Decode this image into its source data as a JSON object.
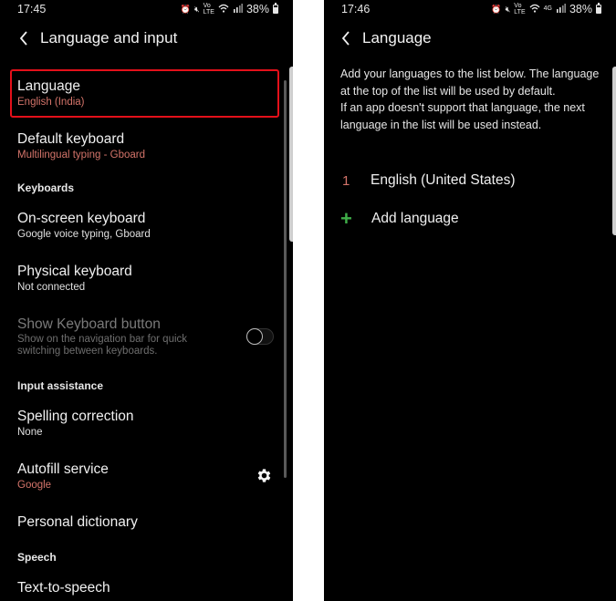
{
  "left_screen": {
    "status_bar": {
      "time": "17:45",
      "icons": [
        "alarm-icon",
        "mute-icon",
        "volte-icon",
        "wifi-icon",
        "signal-icon"
      ],
      "volte_label": "Vo)\nLTE",
      "battery_percent": "38%"
    },
    "app_bar": {
      "title": "Language and input",
      "back_icon": "back-chevron-icon"
    },
    "items": [
      {
        "title": "Language",
        "subtitle": "English (India)",
        "subtitle_style": "accent",
        "highlighted": true
      },
      {
        "title": "Default keyboard",
        "subtitle": "Multilingual typing - Gboard",
        "subtitle_style": "accent"
      }
    ],
    "sections": {
      "keyboards": {
        "header": "Keyboards",
        "items": [
          {
            "title": "On-screen keyboard",
            "subtitle": "Google voice typing, Gboard"
          },
          {
            "title": "Physical keyboard",
            "subtitle": "Not connected"
          },
          {
            "title": "Show Keyboard button",
            "subtitle": "Show on the navigation bar for quick switching between keyboards.",
            "disabled": true,
            "toggle_on": false
          }
        ]
      },
      "input_assistance": {
        "header": "Input assistance",
        "items": [
          {
            "title": "Spelling correction",
            "subtitle": "None"
          },
          {
            "title": "Autofill service",
            "subtitle": "Google",
            "settings_icon": "gear-icon"
          },
          {
            "title": "Personal dictionary"
          }
        ]
      },
      "speech": {
        "header": "Speech",
        "items": [
          {
            "title": "Text-to-speech"
          }
        ]
      }
    }
  },
  "right_screen": {
    "status_bar": {
      "time": "17:46",
      "icons": [
        "alarm-icon",
        "mute-icon",
        "volte-icon",
        "wifi-icon",
        "4g-icon",
        "signal-icon"
      ],
      "network_label": "4G",
      "battery_percent": "38%"
    },
    "app_bar": {
      "title": "Language",
      "back_icon": "back-chevron-icon"
    },
    "description": "Add your languages to the list below. The language at the top of the list will be used by default.\nIf an app doesn't support that language, the next language in the list will be used instead.",
    "description_line1": "Add your languages to the list below. The language at the top of the list will be used by default.",
    "description_line2": "If an app doesn't support that language, the next language in the list will be used instead.",
    "languages": [
      {
        "rank": "1",
        "name": "English (United States)"
      }
    ],
    "add_language": {
      "icon": "plus-icon",
      "label": "Add language"
    }
  },
  "colors": {
    "background": "#000000",
    "accent_subtitle": "#d4746a",
    "highlight_border": "#e4101a",
    "add_green": "#3fae49",
    "separator": "#ffffff"
  }
}
